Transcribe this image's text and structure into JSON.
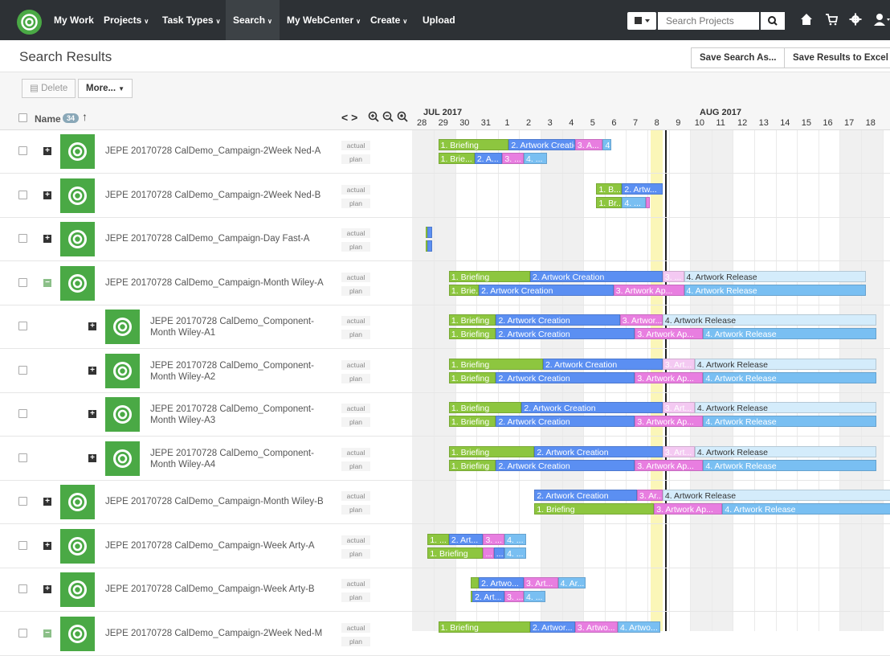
{
  "nav": {
    "items": [
      {
        "label": "My Work",
        "caret": false,
        "active": false
      },
      {
        "label": "Projects",
        "caret": true,
        "active": false
      },
      {
        "label": "Task Types",
        "caret": true,
        "active": false
      },
      {
        "label": "Search",
        "caret": true,
        "active": true
      },
      {
        "label": "My WebCenter",
        "caret": true,
        "active": false
      },
      {
        "label": "Create",
        "caret": true,
        "active": false
      },
      {
        "label": "Upload",
        "caret": false,
        "active": false
      }
    ],
    "search_placeholder": "Search Projects",
    "icons": [
      "print-icon",
      "search-icon",
      "home-icon",
      "cart-icon",
      "gear-icon",
      "user-icon"
    ]
  },
  "header": {
    "title": "Search Results",
    "save_search_label": "Save Search As...",
    "save_excel_label": "Save Results to Excel"
  },
  "toolbar": {
    "delete_label": "Delete",
    "more_label": "More..."
  },
  "columns": {
    "name_label": "Name",
    "count": "34",
    "nav_controls": "< >"
  },
  "timeline": {
    "months": [
      {
        "label": "JUL 2017"
      },
      {
        "label": "AUG 2017"
      }
    ],
    "days": [
      "28",
      "29",
      "30",
      "31",
      "1",
      "2",
      "3",
      "4",
      "5",
      "6",
      "7",
      "8",
      "9",
      "10",
      "11",
      "12",
      "13",
      "14",
      "15",
      "16",
      "17",
      "18"
    ]
  },
  "rows": [
    {
      "name": "JEPE 20170728 CalDemo_Campaign-2Week Ned-A",
      "name2": "",
      "level": 0,
      "expanded": false,
      "actual": [
        {
          "label": "1. Briefing",
          "c": "g",
          "d0": 0.7,
          "d1": 4.0
        },
        {
          "label": "2. Artwork Creation",
          "c": "b",
          "d0": 4.0,
          "d1": 7.1
        },
        {
          "label": "3. A...",
          "c": "p",
          "d0": 7.1,
          "d1": 8.4
        },
        {
          "label": "4",
          "c": "c",
          "d0": 8.4,
          "d1": 8.8
        }
      ],
      "plan": [
        {
          "label": "1. Brie...",
          "c": "g",
          "d0": 0.7,
          "d1": 2.4
        },
        {
          "label": "2. A...",
          "c": "b",
          "d0": 2.4,
          "d1": 3.7
        },
        {
          "label": "3. ...",
          "c": "p",
          "d0": 3.7,
          "d1": 4.7
        },
        {
          "label": "4. ...",
          "c": "c",
          "d0": 4.7,
          "d1": 5.8
        }
      ]
    },
    {
      "name": "JEPE 20170728 CalDemo_Campaign-2Week Ned-B",
      "name2": "",
      "level": 0,
      "expanded": false,
      "actual": [
        {
          "label": "1. B...",
          "c": "g",
          "d0": 8.1,
          "d1": 9.3
        },
        {
          "label": "2. Artw...",
          "c": "b",
          "d0": 9.3,
          "d1": 11.2
        }
      ],
      "plan": [
        {
          "label": "1. Br...",
          "c": "g",
          "d0": 8.1,
          "d1": 9.3
        },
        {
          "label": "4. ...",
          "c": "c",
          "d0": 9.3,
          "d1": 10.4
        },
        {
          "label": "",
          "c": "p",
          "d0": 10.4,
          "d1": 10.6
        }
      ]
    },
    {
      "name": "JEPE 20170728 CalDemo_Campaign-Day Fast-A",
      "name2": "",
      "level": 0,
      "expanded": false,
      "actual": [
        {
          "label": "",
          "c": "g",
          "d0": 0.1,
          "d1": 0.2
        },
        {
          "label": "",
          "c": "b",
          "d0": 0.2,
          "d1": 0.4
        }
      ],
      "plan": [
        {
          "label": "",
          "c": "g",
          "d0": 0.1,
          "d1": 0.2
        },
        {
          "label": "",
          "c": "b",
          "d0": 0.2,
          "d1": 0.4
        }
      ]
    },
    {
      "name": "JEPE 20170728 CalDemo_Campaign-Month Wiley-A",
      "name2": "",
      "level": 0,
      "expanded": true,
      "actual": [
        {
          "label": "1. Briefing",
          "c": "g",
          "d0": 1.2,
          "d1": 5.0
        },
        {
          "label": "2. Artwork Creation",
          "c": "b",
          "d0": 5.0,
          "d1": 11.2
        },
        {
          "label": "3. ...",
          "c": "lp",
          "d0": 11.2,
          "d1": 12.2
        },
        {
          "label": "4. Artwork Release",
          "c": "lc",
          "d0": 12.2,
          "d1": 20.7
        }
      ],
      "plan": [
        {
          "label": "1. Brie...",
          "c": "g",
          "d0": 1.2,
          "d1": 2.6
        },
        {
          "label": "2. Artwork Creation",
          "c": "b",
          "d0": 2.6,
          "d1": 8.9
        },
        {
          "label": "3. Artwork Ap...",
          "c": "p",
          "d0": 8.9,
          "d1": 12.2
        },
        {
          "label": "4. Artwork Release",
          "c": "c",
          "d0": 12.2,
          "d1": 20.7
        }
      ]
    },
    {
      "name": "JEPE 20170728 CalDemo_Component-",
      "name2": "Month Wiley-A1",
      "level": 1,
      "expanded": false,
      "actual": [
        {
          "label": "1. Briefing",
          "c": "g",
          "d0": 1.2,
          "d1": 3.4
        },
        {
          "label": "2. Artwork Creation",
          "c": "b",
          "d0": 3.4,
          "d1": 9.2
        },
        {
          "label": "3. Artwor...",
          "c": "p",
          "d0": 9.2,
          "d1": 11.2
        },
        {
          "label": "4. Artwork Release",
          "c": "lc",
          "d0": 11.2,
          "d1": 21.2
        }
      ],
      "plan": [
        {
          "label": "1. Briefing",
          "c": "g",
          "d0": 1.2,
          "d1": 3.4
        },
        {
          "label": "2. Artwork Creation",
          "c": "b",
          "d0": 3.4,
          "d1": 9.9
        },
        {
          "label": "3. Artwork Ap...",
          "c": "p",
          "d0": 9.9,
          "d1": 13.1
        },
        {
          "label": "4. Artwork Release",
          "c": "c",
          "d0": 13.1,
          "d1": 21.2
        }
      ]
    },
    {
      "name": "JEPE 20170728 CalDemo_Component-",
      "name2": "Month Wiley-A2",
      "level": 1,
      "expanded": false,
      "actual": [
        {
          "label": "1. Briefing",
          "c": "g",
          "d0": 1.2,
          "d1": 5.6
        },
        {
          "label": "2. Artwork Creation",
          "c": "b",
          "d0": 5.6,
          "d1": 11.2
        },
        {
          "label": "3. Art...",
          "c": "lp",
          "d0": 11.2,
          "d1": 12.7
        },
        {
          "label": "4. Artwork Release",
          "c": "lc",
          "d0": 12.7,
          "d1": 21.2
        }
      ],
      "plan": [
        {
          "label": "1. Briefing",
          "c": "g",
          "d0": 1.2,
          "d1": 3.4
        },
        {
          "label": "2. Artwork Creation",
          "c": "b",
          "d0": 3.4,
          "d1": 9.9
        },
        {
          "label": "3. Artwork Ap...",
          "c": "p",
          "d0": 9.9,
          "d1": 13.1
        },
        {
          "label": "4. Artwork Release",
          "c": "c",
          "d0": 13.1,
          "d1": 21.2
        }
      ]
    },
    {
      "name": "JEPE 20170728 CalDemo_Component-",
      "name2": "Month Wiley-A3",
      "level": 1,
      "expanded": false,
      "actual": [
        {
          "label": "1. Briefing",
          "c": "g",
          "d0": 1.2,
          "d1": 4.6
        },
        {
          "label": "2. Artwork Creation",
          "c": "b",
          "d0": 4.6,
          "d1": 11.2
        },
        {
          "label": "3. Art...",
          "c": "lp",
          "d0": 11.2,
          "d1": 12.7
        },
        {
          "label": "4. Artwork Release",
          "c": "lc",
          "d0": 12.7,
          "d1": 21.2
        }
      ],
      "plan": [
        {
          "label": "1. Briefing",
          "c": "g",
          "d0": 1.2,
          "d1": 3.4
        },
        {
          "label": "2. Artwork Creation",
          "c": "b",
          "d0": 3.4,
          "d1": 9.9
        },
        {
          "label": "3. Artwork Ap...",
          "c": "p",
          "d0": 9.9,
          "d1": 13.1
        },
        {
          "label": "4. Artwork Release",
          "c": "c",
          "d0": 13.1,
          "d1": 21.2
        }
      ]
    },
    {
      "name": "JEPE 20170728 CalDemo_Component-",
      "name2": "Month Wiley-A4",
      "level": 1,
      "expanded": false,
      "actual": [
        {
          "label": "1. Briefing",
          "c": "g",
          "d0": 1.2,
          "d1": 5.2
        },
        {
          "label": "2. Artwork Creation",
          "c": "b",
          "d0": 5.2,
          "d1": 11.2
        },
        {
          "label": "3. Art...",
          "c": "lp",
          "d0": 11.2,
          "d1": 12.7
        },
        {
          "label": "4. Artwork Release",
          "c": "lc",
          "d0": 12.7,
          "d1": 21.2
        }
      ],
      "plan": [
        {
          "label": "1. Briefing",
          "c": "g",
          "d0": 1.2,
          "d1": 3.4
        },
        {
          "label": "2. Artwork Creation",
          "c": "b",
          "d0": 3.4,
          "d1": 9.9
        },
        {
          "label": "3. Artwork Ap...",
          "c": "p",
          "d0": 9.9,
          "d1": 13.1
        },
        {
          "label": "4. Artwork Release",
          "c": "c",
          "d0": 13.1,
          "d1": 21.2
        }
      ]
    },
    {
      "name": "JEPE 20170728 CalDemo_Campaign-Month Wiley-B",
      "name2": "",
      "level": 0,
      "expanded": false,
      "actual": [
        {
          "label": "2. Artwork Creation",
          "c": "b",
          "d0": 5.2,
          "d1": 10.0
        },
        {
          "label": "3. Ar...",
          "c": "p",
          "d0": 10.0,
          "d1": 11.2
        },
        {
          "label": "4. Artwork Release",
          "c": "lc",
          "d0": 11.2,
          "d1": 22.0
        }
      ],
      "plan": [
        {
          "label": "1. Briefing",
          "c": "g",
          "d0": 5.2,
          "d1": 10.8
        },
        {
          "label": "3. Artwork Ap...",
          "c": "p",
          "d0": 10.8,
          "d1": 14.0
        },
        {
          "label": "4. Artwork Release",
          "c": "c",
          "d0": 14.0,
          "d1": 22.0
        }
      ]
    },
    {
      "name": "JEPE 20170728 CalDemo_Campaign-Week Arty-A",
      "name2": "",
      "level": 0,
      "expanded": false,
      "actual": [
        {
          "label": "1. ...",
          "c": "g",
          "d0": 0.2,
          "d1": 1.2
        },
        {
          "label": "2. Art...",
          "c": "b",
          "d0": 1.2,
          "d1": 2.8
        },
        {
          "label": "3. ...",
          "c": "p",
          "d0": 2.8,
          "d1": 3.8
        },
        {
          "label": "4. ...",
          "c": "c",
          "d0": 3.8,
          "d1": 4.8
        }
      ],
      "plan": [
        {
          "label": "1. Briefing",
          "c": "g",
          "d0": 0.2,
          "d1": 2.8
        },
        {
          "label": "...",
          "c": "p",
          "d0": 2.8,
          "d1": 3.3
        },
        {
          "label": "...",
          "c": "b",
          "d0": 3.3,
          "d1": 3.8
        },
        {
          "label": "4. ...",
          "c": "c",
          "d0": 3.8,
          "d1": 4.8
        }
      ]
    },
    {
      "name": "JEPE 20170728 CalDemo_Campaign-Week Arty-B",
      "name2": "",
      "level": 0,
      "expanded": false,
      "actual": [
        {
          "label": "",
          "c": "g",
          "d0": 2.2,
          "d1": 2.6
        },
        {
          "label": "2. Artwo...",
          "c": "b",
          "d0": 2.6,
          "d1": 4.7
        },
        {
          "label": "3. Art...",
          "c": "p",
          "d0": 4.7,
          "d1": 6.3
        },
        {
          "label": "4. Ar...",
          "c": "c",
          "d0": 6.3,
          "d1": 7.6
        }
      ],
      "plan": [
        {
          "label": "",
          "c": "g",
          "d0": 2.2,
          "d1": 2.3
        },
        {
          "label": "2. Art...",
          "c": "b",
          "d0": 2.3,
          "d1": 3.8
        },
        {
          "label": "3. ...",
          "c": "p",
          "d0": 3.8,
          "d1": 4.7
        },
        {
          "label": "4. ...",
          "c": "c",
          "d0": 4.7,
          "d1": 5.7
        }
      ]
    },
    {
      "name": "JEPE 20170728 CalDemo_Campaign-2Week Ned-M",
      "name2": "",
      "level": 0,
      "expanded": true,
      "actual": [
        {
          "label": "1. Briefing",
          "c": "g",
          "d0": 0.7,
          "d1": 5.0
        },
        {
          "label": "2. Artwor...",
          "c": "b",
          "d0": 5.0,
          "d1": 7.1
        },
        {
          "label": "3. Artwo...",
          "c": "p",
          "d0": 7.1,
          "d1": 9.1
        },
        {
          "label": "4. Artwo...",
          "c": "c",
          "d0": 9.1,
          "d1": 11.1
        }
      ],
      "plan": []
    }
  ],
  "labels": {
    "actual": "actual",
    "plan": "plan"
  }
}
